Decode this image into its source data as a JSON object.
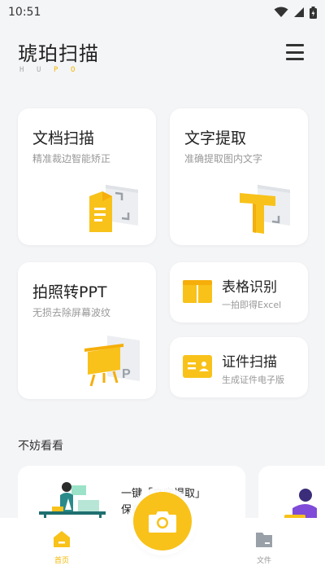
{
  "status_bar": {
    "time": "10:51",
    "icons": [
      "wifi-icon",
      "signal-icon",
      "battery-icon"
    ]
  },
  "header": {
    "title": "琥珀扫描",
    "subtitle_letters": [
      "H",
      "U",
      "P",
      "O"
    ],
    "menu_icon": "hamburger-menu-icon"
  },
  "cards": {
    "scan": {
      "title": "文档扫描",
      "subtitle": "精准裁边智能矫正"
    },
    "text": {
      "title": "文字提取",
      "subtitle": "准确提取图内文字"
    },
    "ppt": {
      "title": "拍照转PPT",
      "subtitle": "无损去除屏幕波纹"
    },
    "table": {
      "title": "表格识别",
      "subtitle": "一拍即得Excel"
    },
    "cert": {
      "title": "证件扫描",
      "subtitle": "生成证件电子版"
    }
  },
  "section": {
    "title": "不妨看看"
  },
  "promo": {
    "line1": "一键「文字提取」",
    "line2": "保存"
  },
  "bottom_nav": {
    "home": {
      "label": "首页",
      "icon": "home-icon",
      "active": true
    },
    "files": {
      "label": "文件",
      "icon": "folder-icon",
      "active": false
    },
    "camera_icon": "camera-icon"
  },
  "colors": {
    "accent": "#f8c21a",
    "background": "#f4f5f7",
    "card": "#ffffff"
  }
}
